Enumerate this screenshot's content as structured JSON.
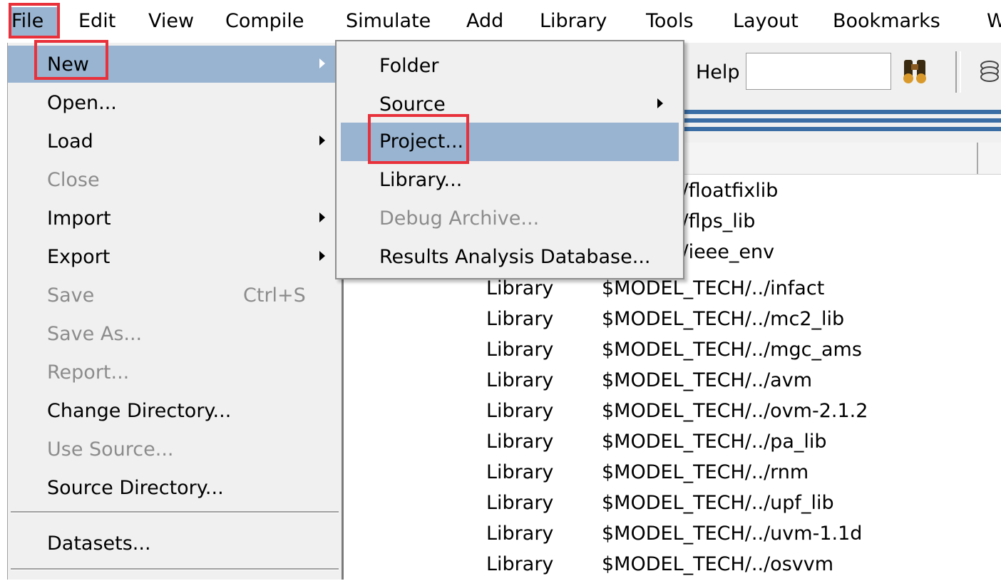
{
  "menubar": {
    "items": [
      {
        "label": "File"
      },
      {
        "label": "Edit"
      },
      {
        "label": "View"
      },
      {
        "label": "Compile"
      },
      {
        "label": "Simulate"
      },
      {
        "label": "Add"
      },
      {
        "label": "Library"
      },
      {
        "label": "Tools"
      },
      {
        "label": "Layout"
      },
      {
        "label": "Bookmarks"
      },
      {
        "label": "W"
      }
    ]
  },
  "file_menu": {
    "items": [
      {
        "label": "New",
        "state": "highlighted",
        "submenu": true
      },
      {
        "label": "Open..."
      },
      {
        "label": "Load",
        "submenu": true
      },
      {
        "label": "Close",
        "state": "disabled"
      },
      {
        "label": "Import",
        "submenu": true
      },
      {
        "label": "Export",
        "submenu": true
      },
      {
        "label": "Save",
        "shortcut": "Ctrl+S",
        "state": "disabled"
      },
      {
        "label": "Save As...",
        "state": "disabled"
      },
      {
        "label": "Report...",
        "state": "disabled"
      },
      {
        "label": "Change Directory..."
      },
      {
        "label": "Use Source...",
        "state": "disabled"
      },
      {
        "label": "Source Directory..."
      },
      {
        "label": "Datasets..."
      }
    ]
  },
  "new_submenu": {
    "items": [
      {
        "label": "Folder"
      },
      {
        "label": "Source",
        "submenu": true
      },
      {
        "label": "Project...",
        "state": "highlighted"
      },
      {
        "label": "Library..."
      },
      {
        "label": "Debug Archive...",
        "state": "disabled"
      },
      {
        "label": "Results Analysis Database..."
      }
    ]
  },
  "toolbar": {
    "help_label": "Help",
    "help_input_value": "",
    "icons": [
      "find-binoculars-icon",
      "toolbar-stack-icon"
    ]
  },
  "library_list": {
    "rows": [
      {
        "type": "",
        "path": "_TECH/../floatfixlib"
      },
      {
        "type": "",
        "path": "_TECH/../flps_lib"
      },
      {
        "type": "",
        "path": "_TECH/../ieee_env"
      },
      {
        "type": "Library",
        "path": "$MODEL_TECH/../infact"
      },
      {
        "type": "Library",
        "path": "$MODEL_TECH/../mc2_lib"
      },
      {
        "type": "Library",
        "path": "$MODEL_TECH/../mgc_ams"
      },
      {
        "type": "Library",
        "path": "$MODEL_TECH/../avm"
      },
      {
        "type": "Library",
        "path": "$MODEL_TECH/../ovm-2.1.2"
      },
      {
        "type": "Library",
        "path": "$MODEL_TECH/../pa_lib"
      },
      {
        "type": "Library",
        "path": "$MODEL_TECH/../rnm"
      },
      {
        "type": "Library",
        "path": "$MODEL_TECH/../upf_lib"
      },
      {
        "type": "Library",
        "path": "$MODEL_TECH/../uvm-1.1d"
      },
      {
        "type": "Library",
        "path": "$MODEL_TECH/../osvvm"
      }
    ]
  },
  "colors": {
    "highlight": "#99b4d1",
    "annotation_red": "#e8313b",
    "menu_bg": "#f0f0f0",
    "disabled_text": "#8c8c8c"
  }
}
